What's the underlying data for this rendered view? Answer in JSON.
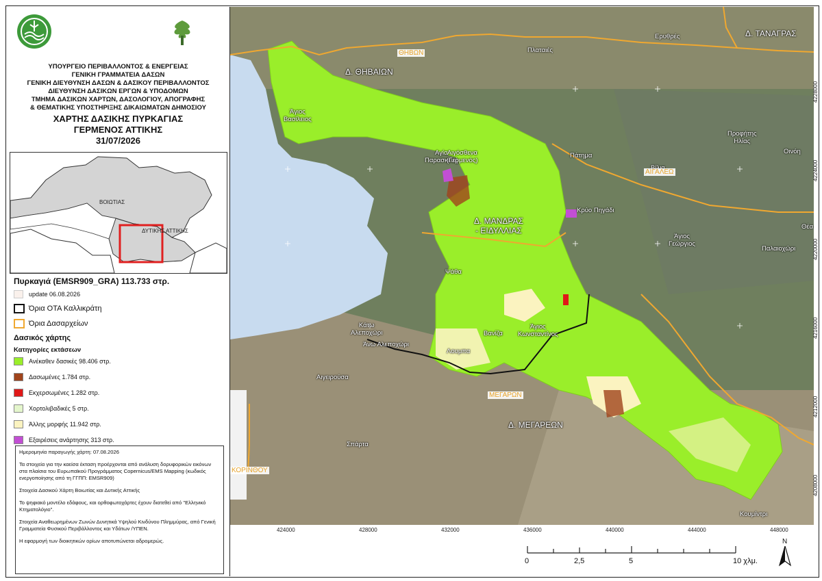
{
  "header": {
    "lines": [
      "ΥΠΟΥΡΓΕΙΟ ΠΕΡΙΒΑΛΛΟΝΤΟΣ & ΕΝΕΡΓΕΙΑΣ",
      "ΓΕΝΙΚΗ ΓΡΑΜΜΑΤΕΙΑ ΔΑΣΩΝ",
      "ΓΕΝΙΚΗ ΔΙΕΥΘΥΝΣΗ ΔΑΣΩΝ & ΔΑΣΙΚΟΥ ΠΕΡΙΒΑΛΛΟΝΤΟΣ",
      "ΔΙΕΥΘΥΝΣΗ ΔΑΣΙΚΩΝ ΕΡΓΩΝ & ΥΠΟΔΟΜΩΝ",
      "ΤΜΗΜΑ ΔΑΣΙΚΩΝ ΧΑΡΤΩΝ, ΔΑΣΟΛΟΓΙΟΥ, ΑΠΟΓΡΑΦΗΣ",
      "& ΘΕΜΑΤΙΚΗΣ ΥΠΟΣΤΗΡΙΞΗΣ ΔΙΚΑΙΩΜΑΤΩΝ ΔΗΜΟΣΙΟΥ"
    ],
    "title1": "ΧΑΡΤΗΣ ΔΑΣΙΚΗΣ ΠΥΡΚΑΓΙΑΣ",
    "title2": "ΓΕΡΜΕΝΟΣ ΑΤΤΙΚΗΣ",
    "date": "31/07/2026"
  },
  "inset": {
    "label_voiotia": "ΒΟΙΩΤΙΑΣ",
    "label_dytiki": "ΔΥΤΙΚΗΣ ΑΤΤΙΚΗΣ"
  },
  "legend": {
    "fire_title": "Πυρκαγιά (EMSR909_GRA)  113.733 στρ.",
    "update": "update 06.08.2026",
    "ota": "Όρια ΟΤΑ Καλλικράτη",
    "dasarxeia": "Όρια Δασαρχείων",
    "forest_map": "Δασικός χάρτης",
    "categories_title": "Κατηγορίες εκτάσεων",
    "categories": [
      {
        "label": "Ανέκαθεν δασικές 98.406 στρ.",
        "color": "#9aee2a"
      },
      {
        "label": "Δασωμένες 1.784 στρ.",
        "color": "#a0441c"
      },
      {
        "label": "Εκχερσωμένες 1.282 στρ.",
        "color": "#e01818"
      },
      {
        "label": "Χορτολιβαδικές 5 στρ.",
        "color": "#e4f6cc"
      },
      {
        "label": "Άλλης μορφής 11.942 στρ.",
        "color": "#fbf3c0"
      },
      {
        "label": "Εξαιρέσεις ανάρτησης 313 στρ.",
        "color": "#c24fd4"
      }
    ],
    "colors": {
      "fire_fill": "#faf1ec",
      "ota_line": "#111111",
      "dasarxeia_line": "#f0a830"
    }
  },
  "notes": [
    "Ημερομηνία παραγωγής χάρτη: 07.08.2026",
    "Τα στοιχεία για την καείσα έκταση προέρχονται από ανάλυση δορυφορικών εικόνων στα πλαίσια του Ευρωπαϊκού Προγράμματος Copernicus/EMS Mapping (κωδικός ενεργοποίησης από τη ΓΓΠΠ: EMSR909)",
    "Στοιχεία Δασικού Χάρτη Βοιωτίας και Δυτικής Αττικής",
    "Το ψηφιακό μοντέλο εδάφους, και ορθοφωτοχάρτες έχουν διατεθεί από \"Ελληνικό Κτηματολόγιο\".",
    "Στοιχεία Αναθεωρημένων Ζωνών Δυνητικά Υψηλού Κινδύνου Πλημμύρας, από Γενική Γραμματεία Φυσικού Περιβάλλοντος και Υδάτων /ΥΠΕΝ.",
    "Η εφαρμογή των διοικητικών ορίων αποτυπώνεται αδρομερώς."
  ],
  "map": {
    "places": {
      "thivaion_label": "ΘΗΒΩΝ",
      "d_thivaion": "Δ. ΘΗΒΑΙΩΝ",
      "agios_vasileios": "Άγιος\nΒασίλειος",
      "plataies": "Πλαταιές",
      "erythres": "Ερυθρές",
      "d_tanagras": "Δ. ΤΑΝΑΓΡΑΣ",
      "profitis_ilias": "Προφήτης\nΗλίας",
      "oinoi": "Οινόη",
      "vilia": "Βίλια",
      "aigaleo": "ΑΙΓΑΛΕΩ",
      "patima": "Πάτημα",
      "agia_paraskevi": "Αγία\nΠαρασκευή",
      "aigosthena": "Αιγόσθενα\n(Γερμενός)",
      "kryo_pigadi": "Κρύο Πηγάδι",
      "d_mandras": "Δ. ΜΑΝΔΡΑΣ\n- ΕΙΔΥΛΛΙΑΣ",
      "thea": "Θέα",
      "agios_georgios": "Άγιος\nΓεώργιος",
      "palaiochori": "Παλαιοχώρι",
      "psatha": "Ψάθα",
      "kato_alepochori": "Κάτω\nΑλεποχώρι",
      "ano_alepochori": "Άνω Αλεποχώρι",
      "vaniza": "Βανίζα",
      "agios_konstantinos": "Άγιος\nΚωνσταντίνος",
      "loumpa": "Λουμπα",
      "aigeirousa": "Αιγειρούσα",
      "megaron": "ΜΕΓΑΡΩΝ",
      "d_megareon": "Δ. ΜΕΓΑΡΕΩΝ",
      "sparta": "Σπάρτα",
      "korinthou": "ΚΟΡΙΝΘΟΥ",
      "koumintri": "Κουμίντρι"
    },
    "x_ticks": [
      "424000",
      "428000",
      "432000",
      "436000",
      "440000",
      "444000",
      "448000"
    ],
    "y_ticks": [
      "4228000",
      "4224000",
      "4220000",
      "4216000",
      "4212000",
      "4208000"
    ]
  },
  "scalebar": {
    "labels": [
      "0",
      "2,5",
      "5",
      "10 χλμ."
    ],
    "north": "N"
  }
}
